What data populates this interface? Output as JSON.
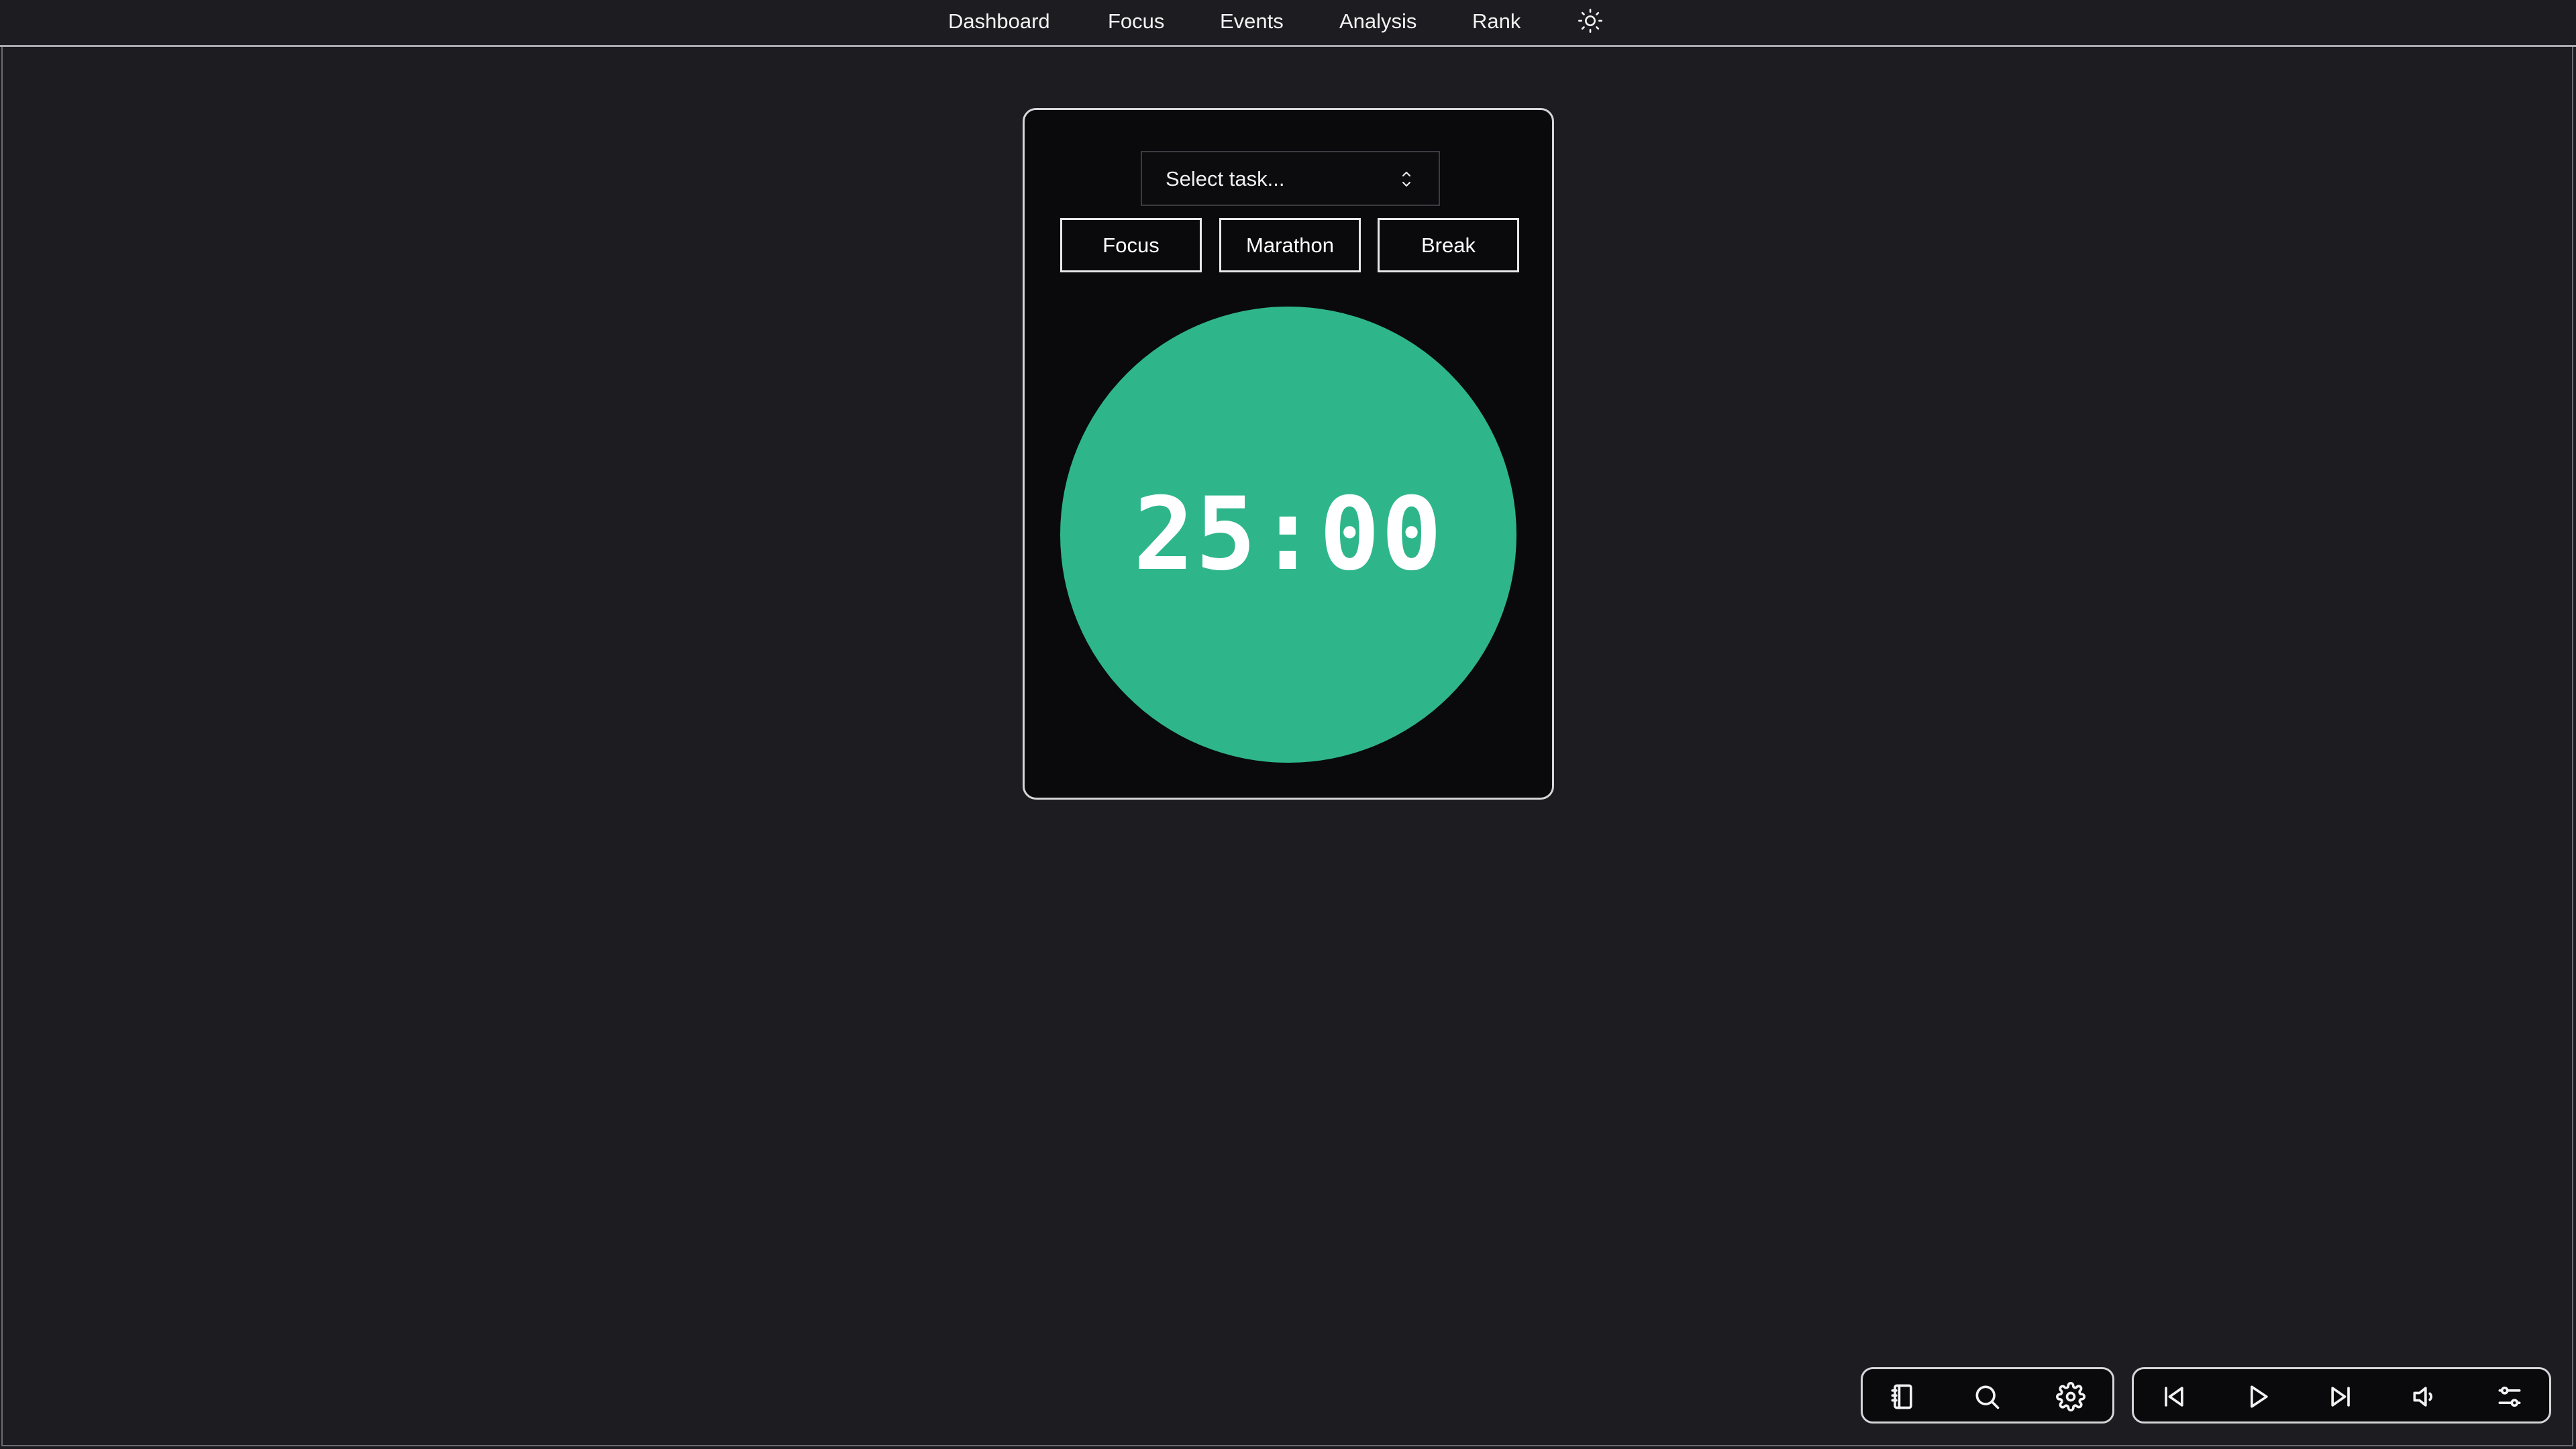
{
  "nav": {
    "items": [
      {
        "label": "Dashboard"
      },
      {
        "label": "Focus"
      },
      {
        "label": "Events"
      },
      {
        "label": "Analysis"
      },
      {
        "label": "Rank"
      }
    ],
    "theme_icon": "sun-icon"
  },
  "timer_card": {
    "task_select": {
      "placeholder": "Select task...",
      "icon": "chevron-up-down-icon"
    },
    "modes": [
      {
        "label": "Focus"
      },
      {
        "label": "Marathon"
      },
      {
        "label": "Break"
      }
    ],
    "time": "25:00",
    "circle_color": "#2eb68a"
  },
  "toolbar_left": {
    "icons": [
      "notebook-icon",
      "search-icon",
      "gear-icon"
    ]
  },
  "toolbar_right": {
    "icons": [
      "skip-back-icon",
      "play-icon",
      "skip-forward-icon",
      "volume-icon",
      "sliders-icon"
    ]
  },
  "colors": {
    "background": "#1c1c21",
    "card": "#0a0a0c",
    "accent": "#2eb68a",
    "border": "#d6d6da"
  }
}
